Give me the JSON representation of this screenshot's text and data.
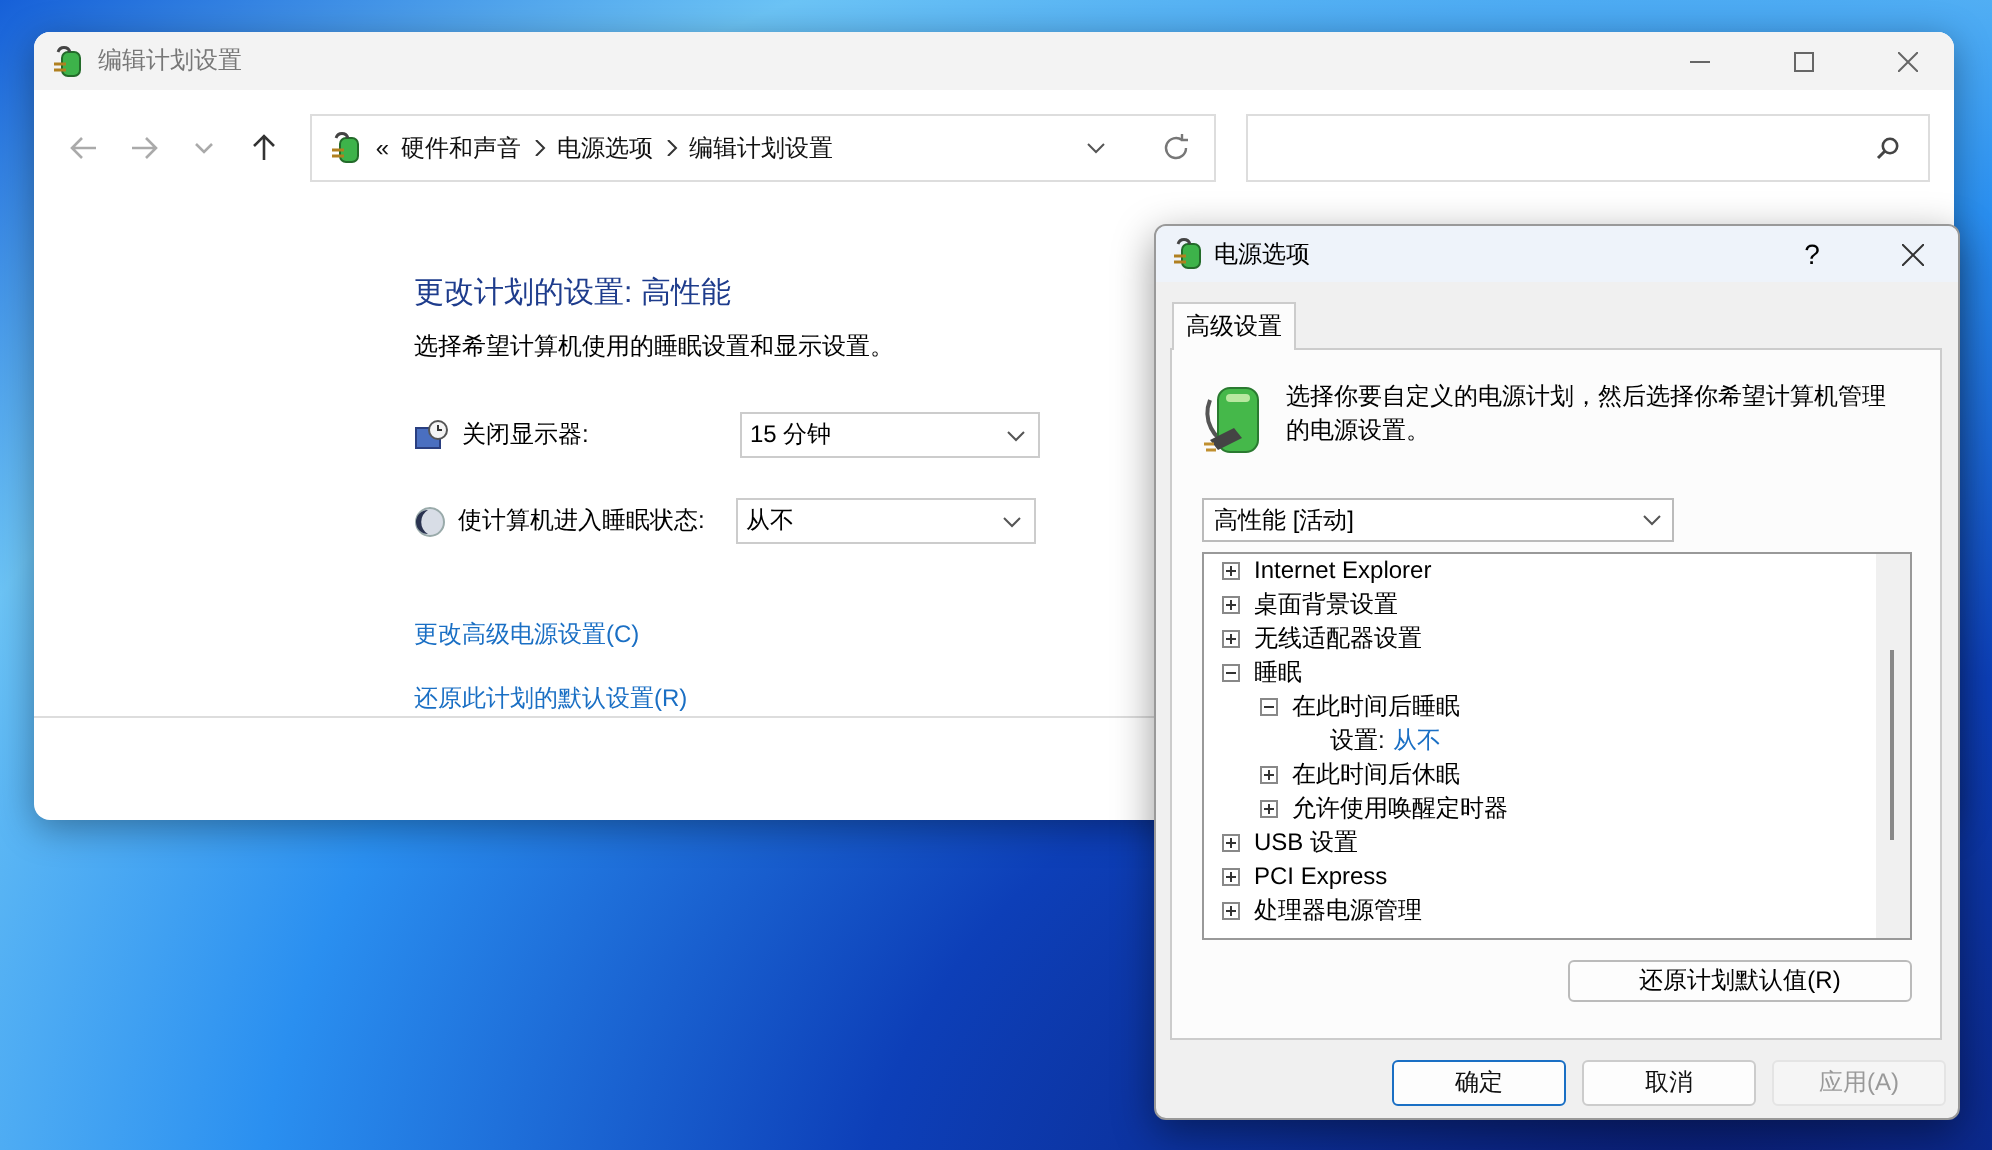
{
  "main_window": {
    "title": "编辑计划设置",
    "nav": [
      {
        "kind": "back",
        "disabled": true
      },
      {
        "kind": "forward",
        "disabled": true
      },
      {
        "kind": "recent",
        "disabled": true
      },
      {
        "kind": "up",
        "disabled": false
      }
    ],
    "breadcrumb": {
      "overflow": "«",
      "items": [
        "硬件和声音",
        "电源选项",
        "编辑计划设置"
      ]
    },
    "heading": "更改计划的设置: 高性能",
    "subtitle": "选择希望计算机使用的睡眠设置和显示设置。",
    "settings": [
      {
        "kind": "display",
        "label": "关闭显示器:",
        "value": "15 分钟"
      },
      {
        "kind": "sleep",
        "label": "使计算机进入睡眠状态:",
        "value": "从不"
      }
    ],
    "links": [
      "更改高级电源设置(C)",
      "还原此计划的默认设置(R)"
    ]
  },
  "dialog": {
    "title": "电源选项",
    "help": "?",
    "tabs": [
      {
        "label": "高级设置",
        "selected": true
      }
    ],
    "description": "选择你要自定义的电源计划，然后选择你希望计算机管理的电源设置。",
    "plan": "高性能 [活动]",
    "tree": [
      {
        "kind": "node",
        "label": "Internet Explorer",
        "expanded": false
      },
      {
        "kind": "node",
        "label": "桌面背景设置",
        "expanded": false
      },
      {
        "kind": "node",
        "label": "无线适配器设置",
        "expanded": false
      },
      {
        "kind": "node",
        "label": "睡眠",
        "expanded": true,
        "children": [
          {
            "kind": "node",
            "label": "在此时间后睡眠",
            "expanded": true,
            "children": [
              {
                "kind": "setting",
                "label": "设置:",
                "value": "从不"
              }
            ]
          },
          {
            "kind": "node",
            "label": "在此时间后休眠",
            "expanded": false
          },
          {
            "kind": "node",
            "label": "允许使用唤醒定时器",
            "expanded": false
          }
        ]
      },
      {
        "kind": "node",
        "label": "USB 设置",
        "expanded": false
      },
      {
        "kind": "node",
        "label": "PCI Express",
        "expanded": false
      },
      {
        "kind": "node",
        "label": "处理器电源管理",
        "expanded": false
      }
    ],
    "restore_button": "还原计划默认值(R)",
    "buttons": [
      {
        "label": "确定",
        "default": true,
        "disabled": false
      },
      {
        "label": "取消",
        "default": false,
        "disabled": false
      },
      {
        "label": "应用(A)",
        "default": false,
        "disabled": true
      }
    ]
  }
}
